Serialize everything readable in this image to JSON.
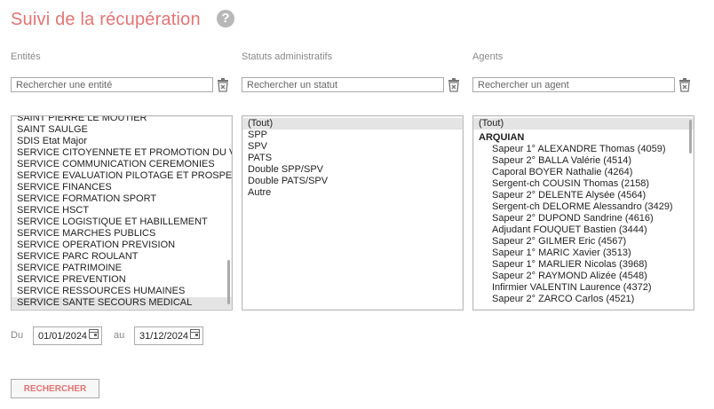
{
  "header": {
    "title": "Suivi de la récupération",
    "help_icon": "?"
  },
  "columns": {
    "entities": {
      "label": "Entités",
      "placeholder": "Rechercher une entité",
      "items": [
        "SAINT PIERRE LE MOUTIER",
        "SAINT SAULGE",
        "SDIS Etat Major",
        "SERVICE CITOYENNETE ET PROMOTION DU VOLONTARIAT",
        "SERVICE COMMUNICATION CEREMONIES",
        "SERVICE EVALUATION PILOTAGE ET PROSPECTIVE",
        "SERVICE FINANCES",
        "SERVICE FORMATION SPORT",
        "SERVICE HSCT",
        "SERVICE LOGISTIQUE ET HABILLEMENT",
        "SERVICE MARCHES PUBLICS",
        "SERVICE OPERATION PREVISION",
        "SERVICE PARC ROULANT",
        "SERVICE PATRIMOINE",
        "SERVICE PREVENTION",
        "SERVICE RESSOURCES HUMAINES",
        "SERVICE SANTE SECOURS MEDICAL"
      ]
    },
    "statuses": {
      "label": "Statuts administratifs",
      "placeholder": "Rechercher un statut",
      "items": [
        "(Tout)",
        "SPP",
        "SPV",
        "PATS",
        "Double SPP/SPV",
        "Double PATS/SPV",
        "Autre"
      ]
    },
    "agents": {
      "label": "Agents",
      "placeholder": "Rechercher un agent",
      "all": "(Tout)",
      "group": "ARQUIAN",
      "items": [
        "Sapeur 1° ALEXANDRE Thomas (4059)",
        "Sapeur 2° BALLA Valérie (4514)",
        "Caporal BOYER Nathalie (4264)",
        "Sergent-ch COUSIN Thomas (2158)",
        "Sapeur 2° DELENTE Alysée (4564)",
        "Sergent-ch DELORME Alessandro (3429)",
        "Sapeur 2° DUPOND Sandrine (4616)",
        "Adjudant FOUQUET Bastien (3444)",
        "Sapeur 2° GILMER Eric (4567)",
        "Sapeur 1° MARIC Xavier (3513)",
        "Sapeur 1° MARLIER Nicolas (3968)",
        "Sapeur 2° RAYMOND Alizée (4548)",
        "Infirmier VALENTIN Laurence (4372)",
        "Sapeur 2° ZARCO Carlos (4521)"
      ]
    }
  },
  "dates": {
    "from_label": "Du",
    "from_value": "01/01/2024",
    "to_label": "au",
    "to_value": "31/12/2024"
  },
  "actions": {
    "search_label": "RECHERCHER"
  },
  "colors": {
    "accent": "#e57373",
    "selected_bg": "#e4e4e4"
  },
  "icons": {
    "clear": "clear-filter-icon",
    "calendar": "calendar-icon",
    "help": "help-icon"
  }
}
